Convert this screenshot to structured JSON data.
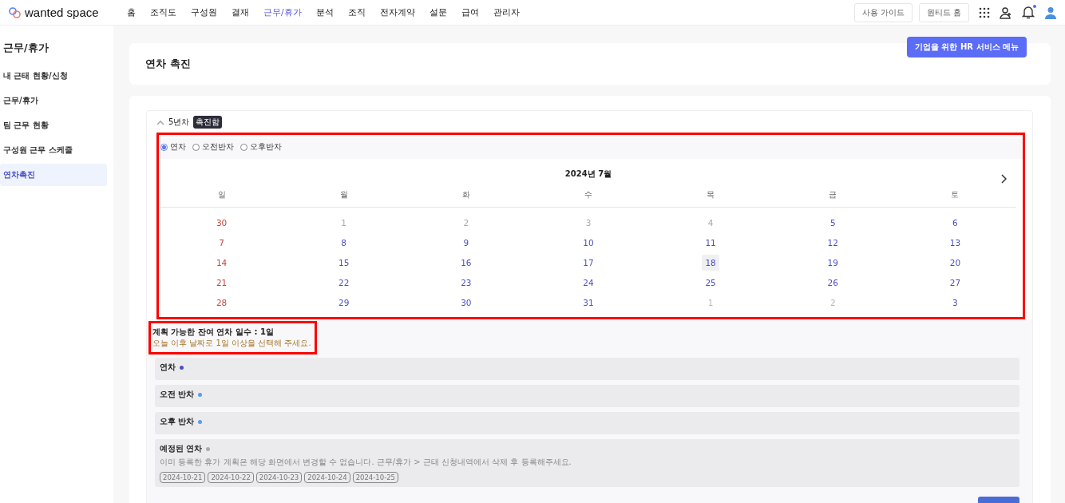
{
  "header": {
    "logo": "wanted space",
    "nav": [
      {
        "label": "홈",
        "selected": false
      },
      {
        "label": "조직도",
        "selected": false
      },
      {
        "label": "구성원",
        "selected": false
      },
      {
        "label": "결재",
        "selected": false
      },
      {
        "label": "근무/휴가",
        "selected": true
      },
      {
        "label": "분석",
        "selected": false
      },
      {
        "label": "조직",
        "selected": false
      },
      {
        "label": "전자계약",
        "selected": false
      },
      {
        "label": "설문",
        "selected": false
      },
      {
        "label": "급여",
        "selected": false
      },
      {
        "label": "관리자",
        "selected": false
      }
    ],
    "buttons": [
      "사용 가이드",
      "원티드 홈"
    ],
    "tooltip": "기업을 위한 HR 서비스 메뉴",
    "notification_dot": true
  },
  "sidebar": {
    "title": "근무/휴가",
    "items": [
      {
        "label": "내 근태 현황/신청",
        "selected": false
      },
      {
        "label": "근무/휴가",
        "selected": false
      },
      {
        "label": "팀 근무 현황",
        "selected": false
      },
      {
        "label": "구성원 근무 스케줄",
        "selected": false
      },
      {
        "label": "연차촉진",
        "selected": true
      }
    ]
  },
  "page_title": "연차 촉진",
  "section": {
    "title": "5년차",
    "badge": "촉진함",
    "expanded": true,
    "options": [
      {
        "label": "연차",
        "selected": true
      },
      {
        "label": "오전반차",
        "selected": false
      },
      {
        "label": "오후반차",
        "selected": false
      }
    ],
    "calendar": {
      "month": "2024년 7월",
      "weekdays": [
        "일",
        "월",
        "화",
        "수",
        "목",
        "금",
        "토"
      ],
      "weeks": [
        [
          {
            "day": "30",
            "kind": "sunday"
          },
          {
            "day": "1",
            "kind": "past"
          },
          {
            "day": "2",
            "kind": "past"
          },
          {
            "day": "3",
            "kind": "past"
          },
          {
            "day": "4",
            "kind": "past"
          },
          {
            "day": "5",
            "kind": "open"
          },
          {
            "day": "6",
            "kind": "open"
          }
        ],
        [
          {
            "day": "7",
            "kind": "sunday"
          },
          {
            "day": "8",
            "kind": "open"
          },
          {
            "day": "9",
            "kind": "open"
          },
          {
            "day": "10",
            "kind": "open"
          },
          {
            "day": "11",
            "kind": "open"
          },
          {
            "day": "12",
            "kind": "open"
          },
          {
            "day": "13",
            "kind": "open"
          }
        ],
        [
          {
            "day": "14",
            "kind": "sunday"
          },
          {
            "day": "15",
            "kind": "open"
          },
          {
            "day": "16",
            "kind": "open"
          },
          {
            "day": "17",
            "kind": "open"
          },
          {
            "day": "18",
            "kind": "today"
          },
          {
            "day": "19",
            "kind": "open"
          },
          {
            "day": "20",
            "kind": "open"
          }
        ],
        [
          {
            "day": "21",
            "kind": "sunday"
          },
          {
            "day": "22",
            "kind": "open"
          },
          {
            "day": "23",
            "kind": "open"
          },
          {
            "day": "24",
            "kind": "open"
          },
          {
            "day": "25",
            "kind": "open"
          },
          {
            "day": "26",
            "kind": "open"
          },
          {
            "day": "27",
            "kind": "open"
          }
        ],
        [
          {
            "day": "28",
            "kind": "sunday"
          },
          {
            "day": "29",
            "kind": "open"
          },
          {
            "day": "30",
            "kind": "open"
          },
          {
            "day": "31",
            "kind": "open"
          },
          {
            "day": "1",
            "kind": "outside"
          },
          {
            "day": "2",
            "kind": "outside"
          },
          {
            "day": "3",
            "kind": "open"
          }
        ]
      ]
    },
    "remaining": "계획 가능한 잔여 연차 일수 : 1일",
    "hint": "오늘 이후 날짜로 1일 이상을 선택해 주세요.",
    "groups": [
      {
        "title": "연차",
        "color": "#4a4fc4"
      },
      {
        "title": "오전 반차",
        "color": "#5b9bf0"
      },
      {
        "title": "오후 반차",
        "color": "#5b9bf0"
      },
      {
        "title": "예정된 연차",
        "color": "#aaaaaa",
        "note": "이미 등록한 휴가 계획은 해당 화면에서 변경할 수 없습니다. 근무/휴가 > 근태 신청내역에서 삭제 후 등록해주세요.",
        "dates": [
          "2024-10-21",
          "2024-10-22",
          "2024-10-23",
          "2024-10-24",
          "2024-10-25"
        ]
      }
    ]
  }
}
